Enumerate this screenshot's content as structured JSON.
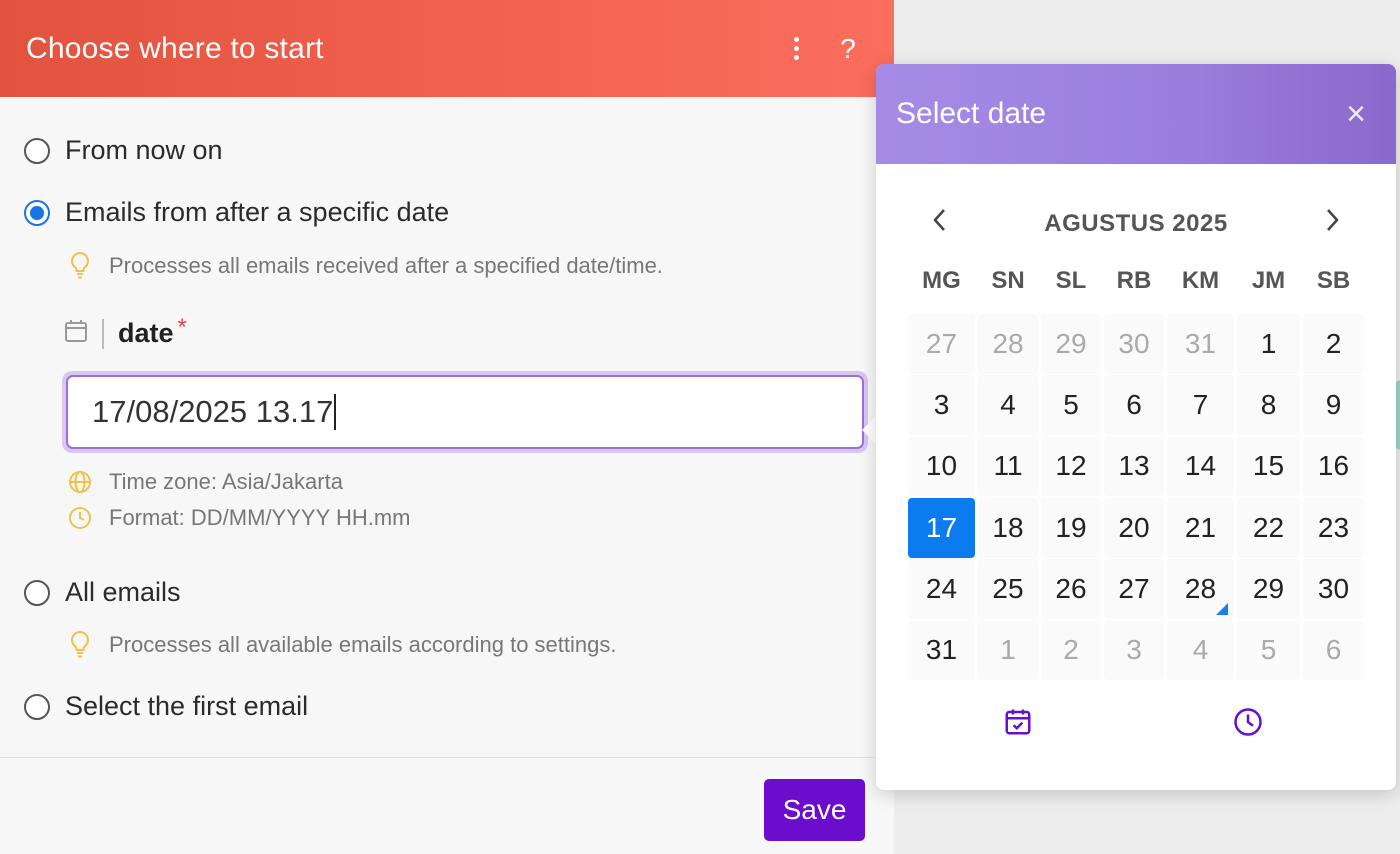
{
  "dialog": {
    "title": "Choose where to start",
    "more_icon": "more-vertical-icon",
    "help_label": "?"
  },
  "options": {
    "from_now": "From now on",
    "after_date": "Emails from after a specific date",
    "after_date_hint": "Processes all emails received after a specified date/time.",
    "all_emails": "All emails",
    "all_emails_hint": "Processes all available emails according to settings.",
    "select_first": "Select the first email",
    "selected": "after_date"
  },
  "date_field": {
    "label": "date",
    "required_mark": "*",
    "value": "17/08/2025 13.17",
    "timezone": "Time zone: Asia/Jakarta",
    "format": "Format: DD/MM/YYYY HH.mm"
  },
  "footer": {
    "save_label": "Save"
  },
  "picker": {
    "title": "Select date",
    "close_label": "×",
    "prev_label": "‹",
    "next_label": "›",
    "month_label": "AGUSTUS 2025",
    "weekdays": [
      "MG",
      "SN",
      "SL",
      "RB",
      "KM",
      "JM",
      "SB"
    ],
    "weeks": [
      [
        {
          "d": "27",
          "m": true
        },
        {
          "d": "28",
          "m": true
        },
        {
          "d": "29",
          "m": true
        },
        {
          "d": "30",
          "m": true
        },
        {
          "d": "31",
          "m": true
        },
        {
          "d": "1"
        },
        {
          "d": "2"
        }
      ],
      [
        {
          "d": "3"
        },
        {
          "d": "4"
        },
        {
          "d": "5"
        },
        {
          "d": "6"
        },
        {
          "d": "7"
        },
        {
          "d": "8"
        },
        {
          "d": "9"
        }
      ],
      [
        {
          "d": "10"
        },
        {
          "d": "11"
        },
        {
          "d": "12"
        },
        {
          "d": "13"
        },
        {
          "d": "14"
        },
        {
          "d": "15"
        },
        {
          "d": "16"
        }
      ],
      [
        {
          "d": "17",
          "sel": true
        },
        {
          "d": "18"
        },
        {
          "d": "19"
        },
        {
          "d": "20"
        },
        {
          "d": "21"
        },
        {
          "d": "22"
        },
        {
          "d": "23"
        }
      ],
      [
        {
          "d": "24"
        },
        {
          "d": "25"
        },
        {
          "d": "26"
        },
        {
          "d": "27"
        },
        {
          "d": "28",
          "today": true
        },
        {
          "d": "29"
        },
        {
          "d": "30"
        }
      ],
      [
        {
          "d": "31"
        },
        {
          "d": "1",
          "m": true
        },
        {
          "d": "2",
          "m": true
        },
        {
          "d": "3",
          "m": true
        },
        {
          "d": "4",
          "m": true
        },
        {
          "d": "5",
          "m": true
        },
        {
          "d": "6",
          "m": true
        }
      ]
    ],
    "footer_icons": [
      "calendar-check-icon",
      "clock-icon"
    ]
  },
  "colors": {
    "header_red": "#e2533f",
    "picker_purple": "#9a7ddd",
    "selected_blue": "#0b7cf0",
    "save_purple": "#6a0dcc",
    "hint_yellow": "#f0c24a"
  }
}
